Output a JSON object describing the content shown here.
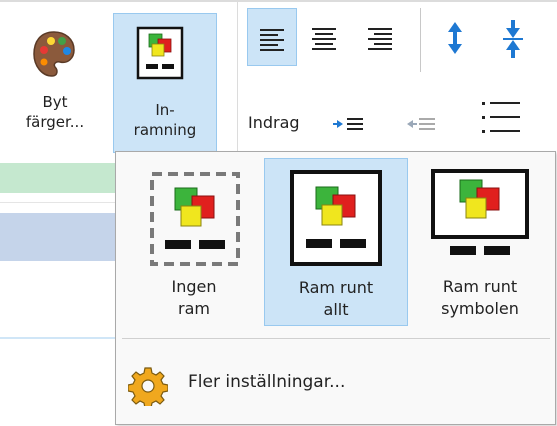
{
  "ribbon": {
    "byt_farger": {
      "line1": "Byt",
      "line2": "färger...",
      "icon": "palette-icon"
    },
    "inramning": {
      "line1": "In-",
      "line2": "ramning",
      "icon": "frame-icon"
    },
    "alignment_tools": [
      {
        "name": "align-left",
        "icon": "align-left-icon",
        "selected": true
      },
      {
        "name": "align-center",
        "icon": "align-center-icon",
        "selected": false
      },
      {
        "name": "align-right",
        "icon": "align-right-icon",
        "selected": false
      },
      {
        "name": "expand-vertical",
        "icon": "arrows-expand-vertical-icon",
        "selected": false
      },
      {
        "name": "compress-vertical",
        "icon": "arrows-compress-vertical-icon",
        "selected": false
      }
    ],
    "indrag_label": "Indrag",
    "indent_tools": [
      "indent-increase-icon",
      "indent-decrease-icon",
      "bullet-list-icon"
    ]
  },
  "dropdown": {
    "options": [
      {
        "line1": "Ingen",
        "line2": "ram",
        "selected": false
      },
      {
        "line1": "Ram runt",
        "line2": "allt",
        "selected": true
      },
      {
        "line1": "Ram runt",
        "line2": "symbolen",
        "selected": false
      }
    ],
    "more_settings": "Fler inställningar..."
  },
  "colors": {
    "selected_bg": "#cce4f7",
    "selected_border": "#99c9ef",
    "arrow_blue": "#1e78d2",
    "symbol_green": "#3cb43c",
    "symbol_red": "#e0201e",
    "symbol_yellow": "#f0e61e",
    "gear_orange": "#f0a81e"
  }
}
